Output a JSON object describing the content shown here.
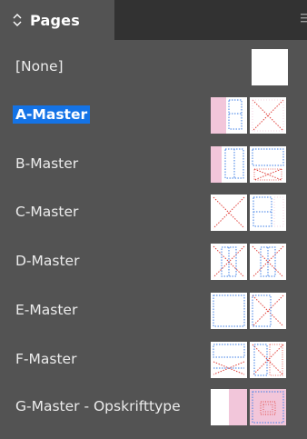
{
  "panel": {
    "tab_label": "Pages",
    "tab_icon": "chevron-updown-icon",
    "menu_icon": "panel-menu-icon"
  },
  "masters": [
    {
      "label": "[None]",
      "selected": false,
      "pages": 1
    },
    {
      "label": "A-Master",
      "selected": true,
      "pages": 2
    },
    {
      "label": "B-Master",
      "selected": false,
      "pages": 2
    },
    {
      "label": "C-Master",
      "selected": false,
      "pages": 2
    },
    {
      "label": "D-Master",
      "selected": false,
      "pages": 2
    },
    {
      "label": "E-Master",
      "selected": false,
      "pages": 2
    },
    {
      "label": "F-Master",
      "selected": false,
      "pages": 2
    },
    {
      "label": "G-Master - Opskrifttype",
      "selected": false,
      "pages": 2
    }
  ],
  "colors": {
    "panel_bg": "#535353",
    "tabbar_bg": "#323232",
    "selection": "#1473e6",
    "guide_blue": "#3d7ee6",
    "guide_red": "#e0403a",
    "pink_fill": "#f2c6da"
  }
}
